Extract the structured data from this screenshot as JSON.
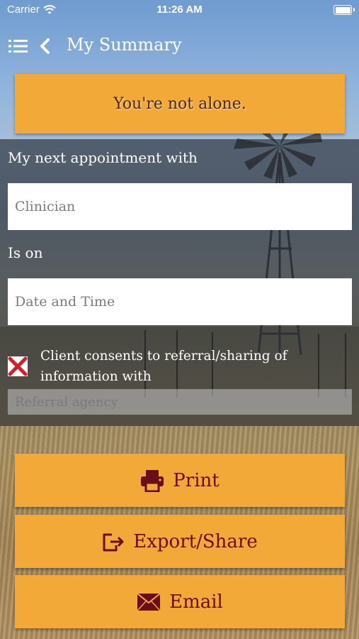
{
  "status_bar": {
    "carrier": "Carrier",
    "time": "11:26 AM"
  },
  "nav": {
    "title": "My Summary",
    "menu_icon": "list-icon",
    "back_icon": "chevron-left-icon"
  },
  "banner": {
    "text": "You're not alone."
  },
  "form": {
    "appointment_label": "My next appointment with",
    "clinician_placeholder": "Clinician",
    "date_label": "Is on",
    "date_placeholder": "Date and Time",
    "consent_text": "Client consents to referral/sharing of information with",
    "consent_checked": true,
    "referral_placeholder": "Referral agency"
  },
  "actions": [
    {
      "label": "Print",
      "icon": "printer-icon"
    },
    {
      "label": "Export/Share",
      "icon": "export-icon"
    },
    {
      "label": "Email",
      "icon": "envelope-icon"
    }
  ],
  "colors": {
    "accent": "#f3a937",
    "button_text": "#6b0f16",
    "checkbox_mark": "#d0202a"
  }
}
